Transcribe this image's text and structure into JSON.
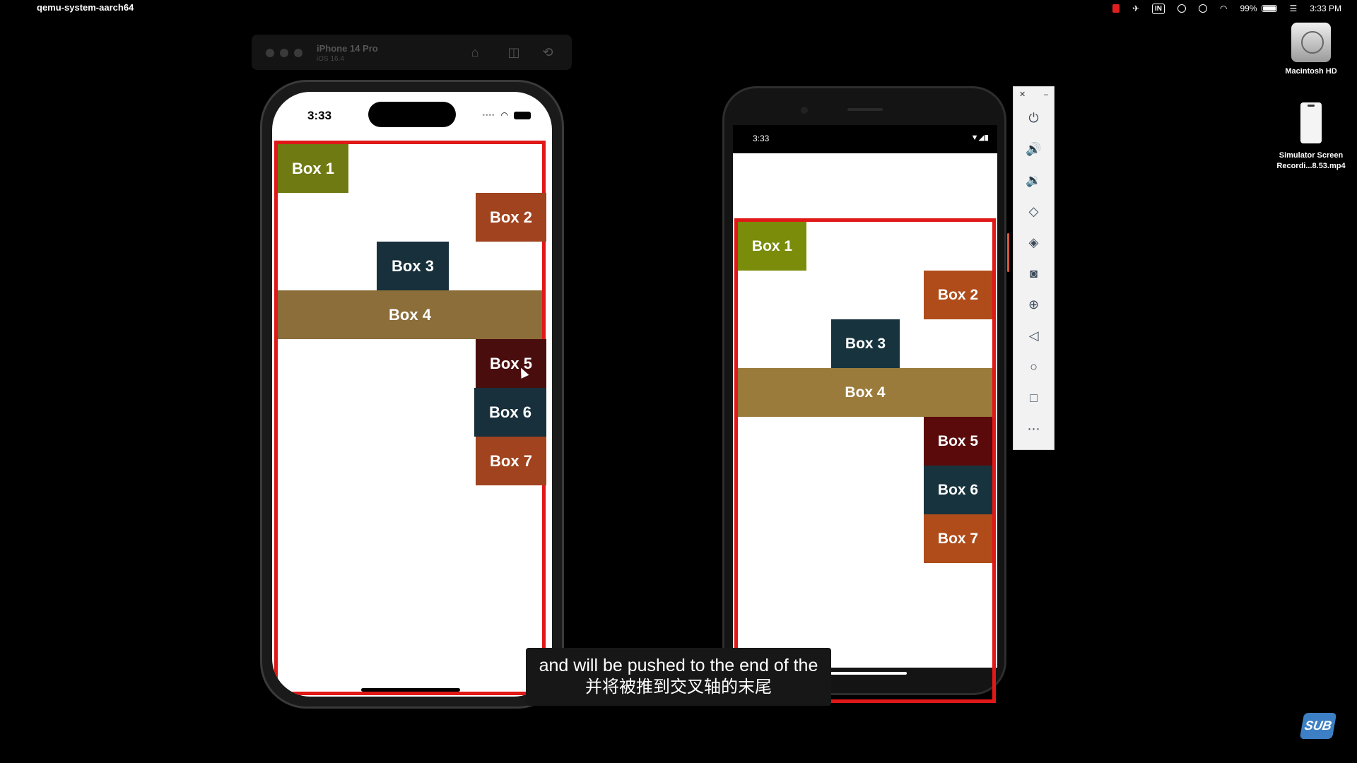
{
  "menubar": {
    "app_name": "qemu-system-aarch64",
    "status": {
      "in_label": "IN",
      "battery": "99%",
      "time": "3:33 PM"
    }
  },
  "desktop": {
    "items": [
      {
        "label": "Macintosh HD"
      },
      {
        "label": "Simulator Screen\nRecordi...8.53.mp4"
      }
    ]
  },
  "ios_simulator": {
    "device": "iPhone 14 Pro",
    "os": "iOS 16.4",
    "status_time": "3:33",
    "boxes": [
      {
        "label": "Box 1",
        "color": "#6f7a12"
      },
      {
        "label": "Box 2",
        "color": "#a0431e"
      },
      {
        "label": "Box 3",
        "color": "#17303c"
      },
      {
        "label": "Box 4",
        "color": "#8b6e3a"
      },
      {
        "label": "Box 5",
        "color": "#4a0d0d"
      },
      {
        "label": "Box 6",
        "color": "#17303c"
      },
      {
        "label": "Box 7",
        "color": "#a0431e"
      }
    ]
  },
  "android_emulator": {
    "status_time": "3:33",
    "boxes": [
      {
        "label": "Box 1",
        "color": "#7a8c0a"
      },
      {
        "label": "Box 2",
        "color": "#b04c1a"
      },
      {
        "label": "Box 3",
        "color": "#17343e"
      },
      {
        "label": "Box 4",
        "color": "#9b7b3b"
      },
      {
        "label": "Box 5",
        "color": "#5a0a0a"
      },
      {
        "label": "Box 6",
        "color": "#17343e"
      },
      {
        "label": "Box 7",
        "color": "#b04c1a"
      }
    ],
    "toolbar": [
      "power-icon",
      "volume-up-icon",
      "volume-down-icon",
      "rotate-left-icon",
      "rotate-right-icon",
      "camera-icon",
      "zoom-icon",
      "back-icon",
      "home-icon",
      "overview-icon",
      "more-icon"
    ]
  },
  "subtitle": {
    "english": "and will be pushed to the end of the",
    "chinese": "并将被推到交叉轴的末尾"
  },
  "watermark": "SUB"
}
